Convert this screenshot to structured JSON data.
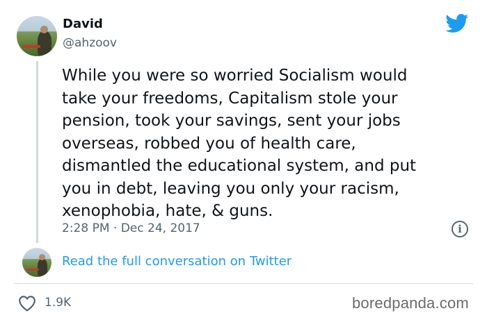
{
  "author": {
    "name": "David",
    "handle": "@ahzoov"
  },
  "tweet": {
    "lines": [
      "While you were so worried Socialism would",
      "take your freedoms, Capitalism stole your",
      "pension, took your savings, sent your jobs",
      "overseas, robbed you of health care,",
      "dismantled the educational system, and put",
      "you in debt, leaving you only your racism,",
      "xenophobia, hate, & guns."
    ],
    "timestamp": "2:28 PM · Dec 24, 2017",
    "info_glyph": "i"
  },
  "conversation_link": "Read the full conversation on Twitter",
  "engagement": {
    "likes": "1.9K"
  },
  "watermark": "boredpanda.com",
  "icons": {
    "brand": "twitter-bird-icon",
    "info": "info-icon",
    "like": "heart-icon"
  },
  "colors": {
    "twitter_blue": "#1d9bf0",
    "text_primary": "#0f1419",
    "text_secondary": "#536471",
    "divider": "#cfd9de"
  }
}
